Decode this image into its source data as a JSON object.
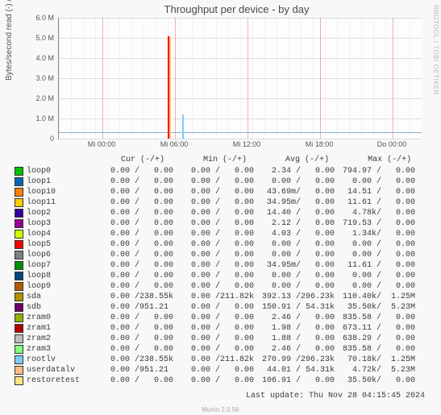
{
  "chart_data": {
    "type": "line",
    "title": "Throughput per device - by day",
    "ylabel": "Bytes/second read (-) / write (+)",
    "ylim": [
      0,
      6000000
    ],
    "yticks": [
      0,
      1000000,
      2000000,
      3000000,
      4000000,
      5000000,
      6000000
    ],
    "ytick_labels": [
      "0",
      "1.0 M",
      "2.0 M",
      "3.0 M",
      "4.0 M",
      "5.0 M",
      "6.0 M"
    ],
    "xticks": [
      "Mi 00:00",
      "Mi 06:00",
      "Mi 12:00",
      "Mi 18:00",
      "Do 00:00"
    ],
    "xtick_pos_pct": [
      12,
      32,
      52,
      72,
      92
    ],
    "note": "Most series are near-zero; one red/orange spike to ~5.2M around Mi 06:00 and a smaller blue spike ~1.2M shortly after. A continuous low blue line ~0.3M across the window."
  },
  "sideprint": "RRDTOOL / TOBI OETIKER",
  "legend_header_label": "",
  "columns": [
    "Cur (-/+)",
    "Min (-/+)",
    "Avg (-/+)",
    "Max (-/+)"
  ],
  "devices": [
    {
      "name": "loop0",
      "color": "#00c000",
      "cur": "0.00 /   0.00",
      "min": "0.00 /   0.00",
      "avg": "2.34 /   0.00",
      "max": "794.97 /   0.00"
    },
    {
      "name": "loop1",
      "color": "#0066b3",
      "cur": "0.00 /   0.00",
      "min": "0.00 /   0.00",
      "avg": "0.00 /   0.00",
      "max": "0.00 /   0.00"
    },
    {
      "name": "loop10",
      "color": "#ff8000",
      "cur": "0.00 /   0.00",
      "min": "0.00 /   0.00",
      "avg": "43.69m/   0.00",
      "max": "14.51 /   0.00"
    },
    {
      "name": "loop11",
      "color": "#ffcc00",
      "cur": "0.00 /   0.00",
      "min": "0.00 /   0.00",
      "avg": "34.95m/   0.00",
      "max": "11.61 /   0.00"
    },
    {
      "name": "loop2",
      "color": "#330099",
      "cur": "0.00 /   0.00",
      "min": "0.00 /   0.00",
      "avg": "14.40 /   0.00",
      "max": "4.78k/   0.00"
    },
    {
      "name": "loop3",
      "color": "#990099",
      "cur": "0.00 /   0.00",
      "min": "0.00 /   0.00",
      "avg": "2.12 /   0.00",
      "max": "719.53 /   0.00"
    },
    {
      "name": "loop4",
      "color": "#ccff00",
      "cur": "0.00 /   0.00",
      "min": "0.00 /   0.00",
      "avg": "4.03 /   0.00",
      "max": "1.34k/   0.00"
    },
    {
      "name": "loop5",
      "color": "#ff0000",
      "cur": "0.00 /   0.00",
      "min": "0.00 /   0.00",
      "avg": "0.00 /   0.00",
      "max": "0.00 /   0.00"
    },
    {
      "name": "loop6",
      "color": "#808080",
      "cur": "0.00 /   0.00",
      "min": "0.00 /   0.00",
      "avg": "0.00 /   0.00",
      "max": "0.00 /   0.00"
    },
    {
      "name": "loop7",
      "color": "#008f00",
      "cur": "0.00 /   0.00",
      "min": "0.00 /   0.00",
      "avg": "34.95m/   0.00",
      "max": "11.61 /   0.00"
    },
    {
      "name": "loop8",
      "color": "#00487d",
      "cur": "0.00 /   0.00",
      "min": "0.00 /   0.00",
      "avg": "0.00 /   0.00",
      "max": "0.00 /   0.00"
    },
    {
      "name": "loop9",
      "color": "#b35a00",
      "cur": "0.00 /   0.00",
      "min": "0.00 /   0.00",
      "avg": "0.00 /   0.00",
      "max": "0.00 /   0.00"
    },
    {
      "name": "sda",
      "color": "#b38f00",
      "cur": "0.00 /238.55k",
      "min": "0.00 /211.82k",
      "avg": "392.13 /296.23k",
      "max": "110.40k/  1.25M"
    },
    {
      "name": "sdb",
      "color": "#6b006b",
      "cur": "0.00 /951.21 ",
      "min": "0.00 /   0.00",
      "avg": "150.91 / 54.31k",
      "max": "35.50k/  5.23M"
    },
    {
      "name": "zram0",
      "color": "#8fb300",
      "cur": "0.00 /   0.00",
      "min": "0.00 /   0.00",
      "avg": "2.46 /   0.00",
      "max": "835.58 /   0.00"
    },
    {
      "name": "zram1",
      "color": "#b30000",
      "cur": "0.00 /   0.00",
      "min": "0.00 /   0.00",
      "avg": "1.98 /   0.00",
      "max": "673.11 /   0.00"
    },
    {
      "name": "zram2",
      "color": "#bebebe",
      "cur": "0.00 /   0.00",
      "min": "0.00 /   0.00",
      "avg": "1.88 /   0.00",
      "max": "638.29 /   0.00"
    },
    {
      "name": "zram3",
      "color": "#80ff80",
      "cur": "0.00 /   0.00",
      "min": "0.00 /   0.00",
      "avg": "2.46 /   0.00",
      "max": "835.58 /   0.00"
    },
    {
      "name": "rootlv",
      "color": "#80c9ff",
      "cur": "0.00 /238.55k",
      "min": "0.00 /211.82k",
      "avg": "270.99 /296.23k",
      "max": "70.18k/  1.25M"
    },
    {
      "name": "userdatalv",
      "color": "#ffc080",
      "cur": "0.00 /951.21 ",
      "min": "0.00 /   0.00",
      "avg": "44.01 / 54.31k",
      "max": "4.72k/  5.23M"
    },
    {
      "name": "restoretest",
      "color": "#ffe680",
      "cur": "0.00 /   0.00",
      "min": "0.00 /   0.00",
      "avg": "106.91 /   0.00",
      "max": "35.50k/   0.00"
    }
  ],
  "last_update": "Last update: Thu Nov 28 04:15:45 2024",
  "munin_version": "Munin 2.0.56"
}
